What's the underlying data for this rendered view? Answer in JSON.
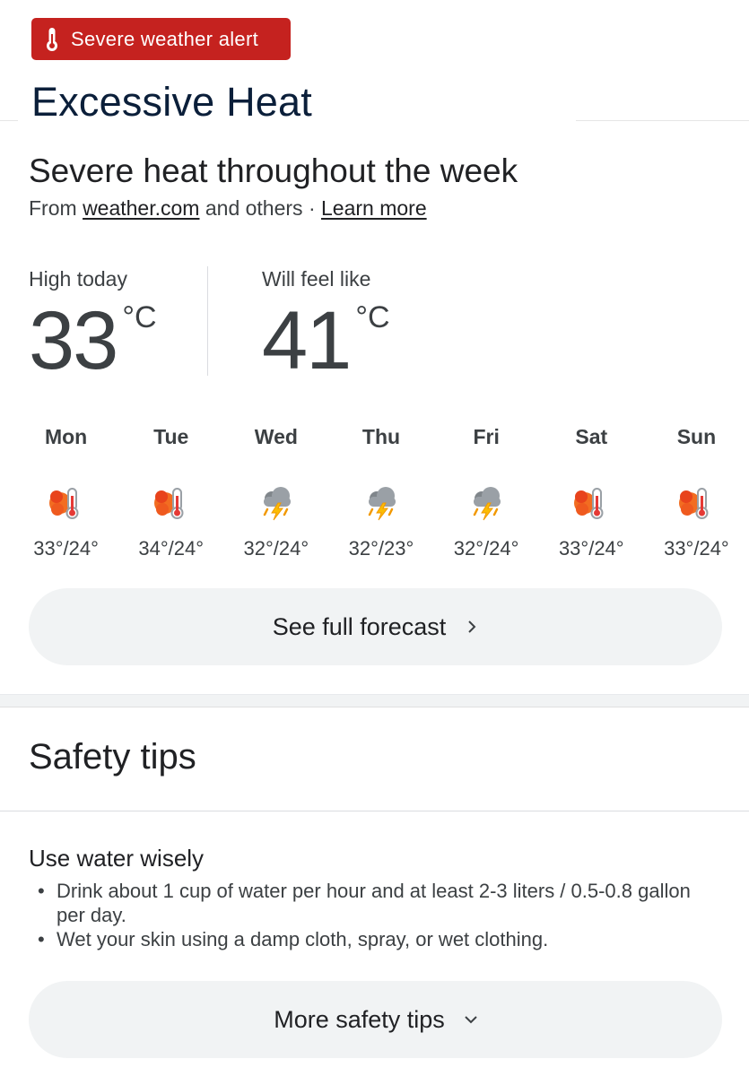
{
  "alert": {
    "label": "Severe weather alert",
    "icon": "thermometer-icon",
    "color": "#c5221f"
  },
  "headline": "Excessive Heat",
  "section": {
    "title": "Severe heat throughout the week",
    "source_prefix": "From ",
    "source_link": "weather.com",
    "source_mid": " and others · ",
    "learn_more": "Learn more"
  },
  "high_today": {
    "label": "High today",
    "value": "33",
    "unit": "°C"
  },
  "feels_like": {
    "label": "Will feel like",
    "value": "41",
    "unit": "°C"
  },
  "forecast": [
    {
      "day": "Mon",
      "icon": "heat-icon",
      "range": "33°/24°"
    },
    {
      "day": "Tue",
      "icon": "heat-icon",
      "range": "34°/24°"
    },
    {
      "day": "Wed",
      "icon": "thunderstorm-icon",
      "range": "32°/24°"
    },
    {
      "day": "Thu",
      "icon": "thunderstorm-icon",
      "range": "32°/23°"
    },
    {
      "day": "Fri",
      "icon": "thunderstorm-icon",
      "range": "32°/24°"
    },
    {
      "day": "Sat",
      "icon": "heat-icon",
      "range": "33°/24°"
    },
    {
      "day": "Sun",
      "icon": "heat-icon",
      "range": "33°/24°"
    }
  ],
  "see_forecast": {
    "label": "See full forecast",
    "icon": "chevron-right-icon"
  },
  "safety": {
    "title": "Safety tips",
    "tip_heading": "Use water wisely",
    "tips": [
      "Drink about 1 cup of water per hour and at least 2-3 liters / 0.5-0.8 gallon per day.",
      "Wet your skin using a damp cloth, spray, or wet clothing."
    ],
    "more_label": "More safety tips",
    "more_icon": "chevron-down-icon"
  }
}
